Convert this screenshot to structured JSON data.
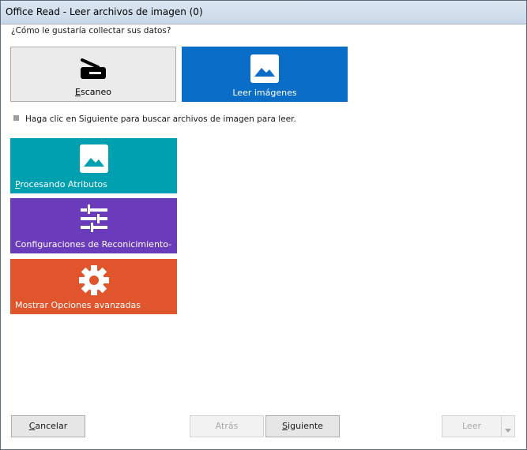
{
  "window": {
    "title": "Office Read - Leer archivos de imagen (0)"
  },
  "question": "¿Cómo le gustaría collectar sus datos?",
  "modes": {
    "scan": {
      "label_first": "E",
      "label_rest": "scaneo",
      "icon": "scanner-icon"
    },
    "read": {
      "label": "Leer imágenes",
      "icon": "image-icon"
    }
  },
  "hint": "Haga clic en Siguiente para buscar archivos de imagen para leer.",
  "tiles": [
    {
      "label_first": "P",
      "label_rest": "rocesando Atributos",
      "icon": "image-icon",
      "color": "#00a0b0"
    },
    {
      "label": "Configuraciones de Reconicimiento-",
      "icon": "sliders-icon",
      "color": "#6a3cbc"
    },
    {
      "label": "Mostrar Opciones avanzadas",
      "icon": "gear-icon",
      "color": "#e0552b"
    }
  ],
  "footer": {
    "cancel_first": "C",
    "cancel_rest": "ancelar",
    "back": "Atrás",
    "next_first": "S",
    "next_rest": "iguiente",
    "read": "Leer"
  },
  "colors": {
    "accent": "#0a6dc8",
    "teal": "#00a0b0",
    "purple": "#6a3cbc",
    "orange": "#e0552b"
  }
}
